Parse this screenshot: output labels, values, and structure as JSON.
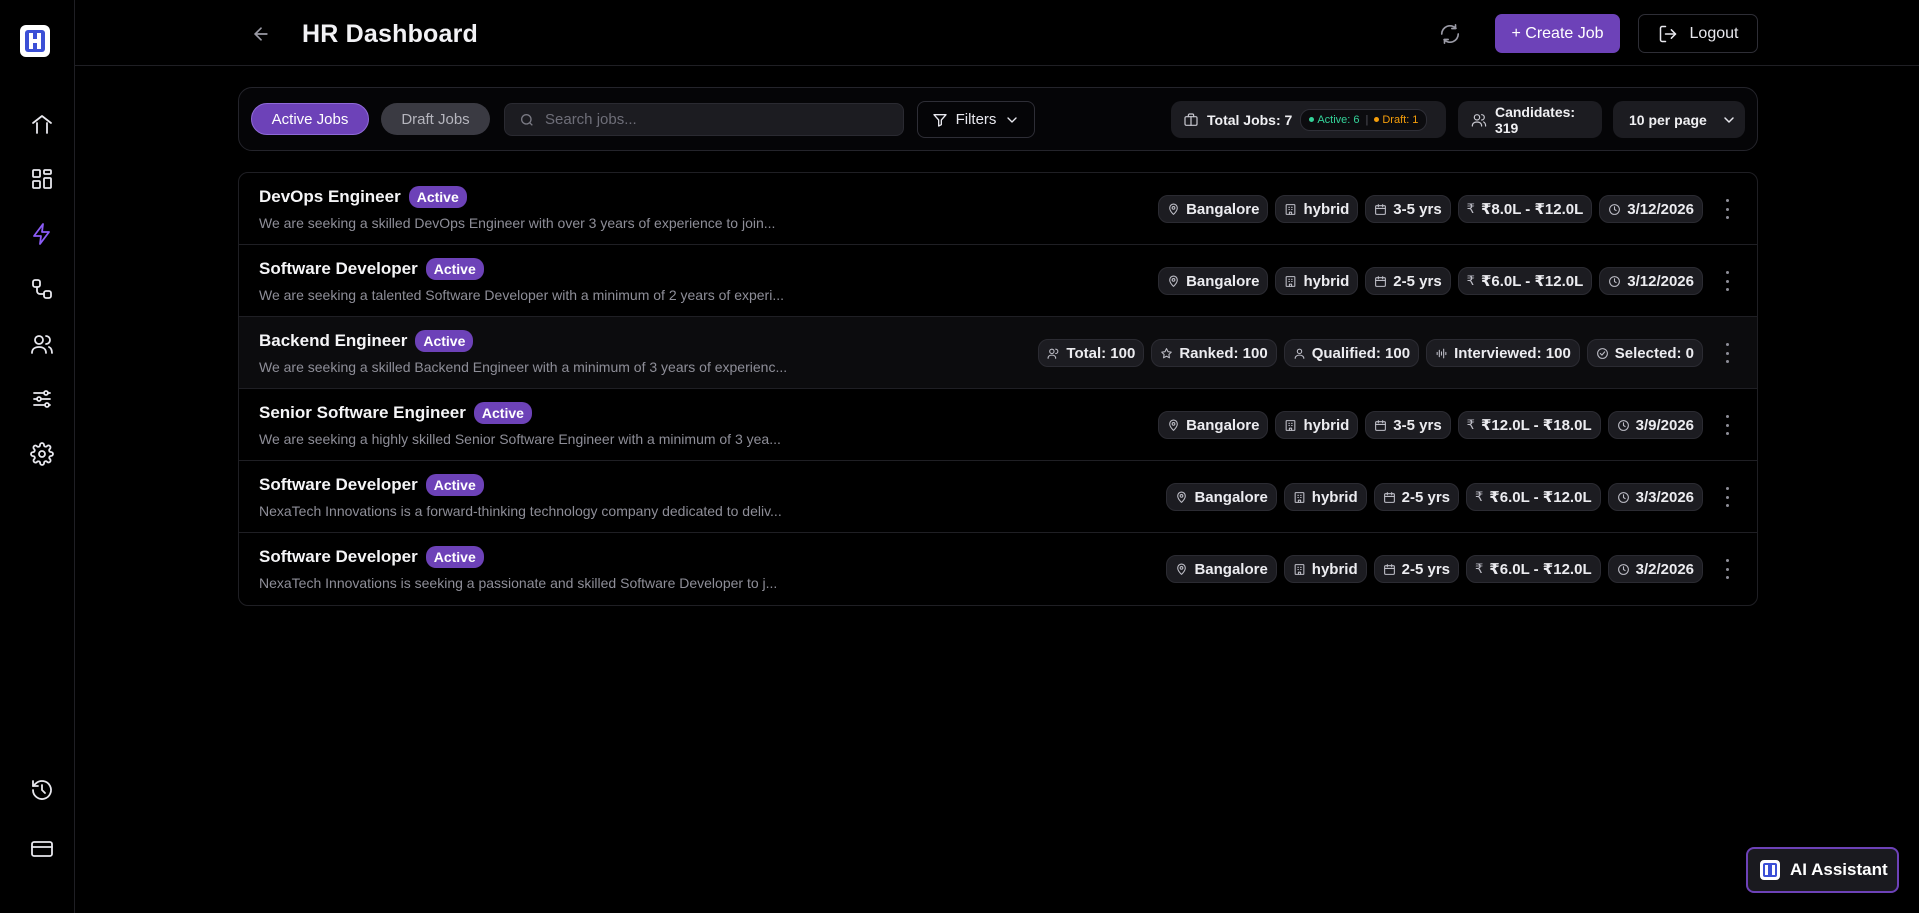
{
  "header": {
    "title": "HR Dashboard",
    "create_label": "+ Create Job",
    "logout_label": "Logout"
  },
  "sidebar": {
    "items": [
      {
        "icon": "home-icon"
      },
      {
        "icon": "dashboard-grid-icon"
      },
      {
        "icon": "lightning-icon",
        "active": true
      },
      {
        "icon": "workflow-icon"
      },
      {
        "icon": "users-icon"
      },
      {
        "icon": "sliders-icon"
      },
      {
        "icon": "settings-gear-icon"
      },
      {
        "icon": "history-icon"
      },
      {
        "icon": "credit-card-icon"
      }
    ]
  },
  "toolbar": {
    "tab_active": "Active Jobs",
    "tab_draft": "Draft Jobs",
    "search_placeholder": "Search jobs...",
    "filters_label": "Filters",
    "total_jobs": "Total Jobs: 7",
    "active_count": "Active: 6",
    "draft_count": "Draft: 1",
    "candidates": "Candidates: 319",
    "per_page": "10 per page"
  },
  "jobs": [
    {
      "title": "DevOps Engineer",
      "status": "Active",
      "description": "We are seeking a skilled DevOps Engineer with over 3 years of experience to join...",
      "location": "Bangalore",
      "mode": "hybrid",
      "experience": "3-5 yrs",
      "salary": "₹8.0L - ₹12.0L",
      "date": "3/12/2026"
    },
    {
      "title": "Software Developer",
      "status": "Active",
      "description": "We are seeking a talented Software Developer with a minimum of 2 years of experi...",
      "location": "Bangalore",
      "mode": "hybrid",
      "experience": "2-5 yrs",
      "salary": "₹6.0L - ₹12.0L",
      "date": "3/12/2026"
    },
    {
      "title": "Backend Engineer",
      "status": "Active",
      "description": "We are seeking a skilled Backend Engineer with a minimum of 3 years of experienc...",
      "stats": {
        "total": "Total: 100",
        "ranked": "Ranked: 100",
        "qualified": "Qualified: 100",
        "interviewed": "Interviewed: 100",
        "selected": "Selected: 0"
      }
    },
    {
      "title": "Senior Software Engineer",
      "status": "Active",
      "description": "We are seeking a highly skilled Senior Software Engineer with a minimum of 3 yea...",
      "location": "Bangalore",
      "mode": "hybrid",
      "experience": "3-5 yrs",
      "salary": "₹12.0L - ₹18.0L",
      "date": "3/9/2026"
    },
    {
      "title": "Software Developer",
      "status": "Active",
      "description": "NexaTech Innovations is a forward-thinking technology company dedicated to deliv...",
      "location": "Bangalore",
      "mode": "hybrid",
      "experience": "2-5 yrs",
      "salary": "₹6.0L - ₹12.0L",
      "date": "3/3/2026"
    },
    {
      "title": "Software Developer",
      "status": "Active",
      "description": "NexaTech Innovations is seeking a passionate and skilled Software Developer to j...",
      "location": "Bangalore",
      "mode": "hybrid",
      "experience": "2-5 yrs",
      "salary": "₹6.0L - ₹12.0L",
      "date": "3/2/2026"
    }
  ],
  "ai_assistant": {
    "label": "AI Assistant"
  },
  "colors": {
    "accent": "#6d42b8",
    "sidebar_active": "#8b5cf6",
    "active_green": "#34d399",
    "draft_orange": "#f59e0b",
    "background": "#000000"
  }
}
